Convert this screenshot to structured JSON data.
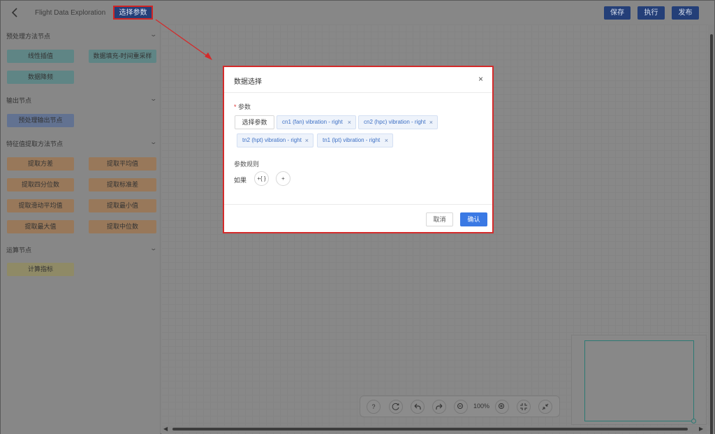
{
  "header": {
    "app_title": "Flight Data Exploration",
    "select_button": "选择参数",
    "save_button": "保存",
    "run_button": "执行",
    "publish_button": "发布"
  },
  "sidebar": {
    "sections": [
      {
        "title": "预处理方法节点",
        "items": [
          "线性插值",
          "数据填充-时间重采样",
          "数据降频"
        ]
      },
      {
        "title": "输出节点",
        "items": [
          "预处理输出节点"
        ]
      },
      {
        "title": "特征值提取方法节点",
        "items": [
          "提取方差",
          "提取平均值",
          "提取四分位数",
          "提取标准差",
          "提取滑动平均值",
          "提取最小值",
          "提取最大值",
          "提取中位数"
        ]
      },
      {
        "title": "运算节点",
        "items": [
          "计算指标"
        ]
      }
    ]
  },
  "toolbar": {
    "help": "?",
    "zoom": "100%"
  },
  "modal": {
    "title": "数据选择",
    "close": "×",
    "param_label": "参数",
    "required_mark": "*",
    "pick_button": "选择参数",
    "tags": [
      "cn1 (fan) vibration - right",
      "cn2 (hpc) vibration - right",
      "tn2 (hpt) vibration - right",
      "tn1 (lpt) vibration - right"
    ],
    "tag_remove": "×",
    "rule_label": "参数规则",
    "if_label": "如果",
    "expr_button": "+{ }",
    "add_button": "+",
    "cancel_button": "取消",
    "confirm_button": "确认"
  },
  "colors": {
    "accent": "#3a79e4",
    "highlight": "#d42a2a",
    "tag_text": "#3c6fc4"
  }
}
